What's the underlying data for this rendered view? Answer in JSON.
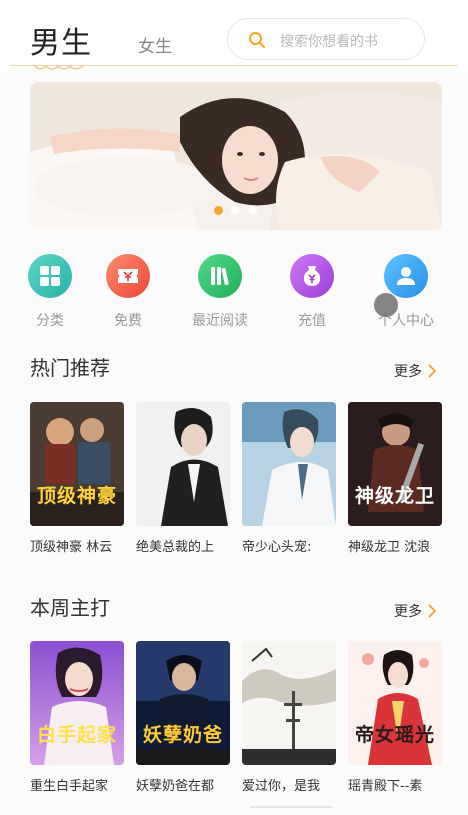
{
  "header": {
    "tab_male": "男生",
    "tab_female": "女生",
    "search_placeholder": "搜索你想看的书"
  },
  "colors": {
    "accent": "#f3a52d",
    "header_line": "#f0d9b4",
    "text_primary": "#333333",
    "text_muted": "#999999"
  },
  "nav": [
    {
      "label": "分类",
      "icon": "grid-icon",
      "color": "#38c6b5"
    },
    {
      "label": "免费",
      "icon": "ticket-icon",
      "color": "#f0614a"
    },
    {
      "label": "最近阅读",
      "icon": "books-icon",
      "color": "#2ec46c"
    },
    {
      "label": "充值",
      "icon": "coin-tag-icon",
      "color": "#b251e4"
    },
    {
      "label": "个人中心",
      "icon": "user-icon",
      "color": "#3fa6f2"
    }
  ],
  "hot": {
    "title": "热门推荐",
    "more": "更多",
    "books": [
      {
        "title": "顶级神豪 林云",
        "cover_text": "顶级神豪"
      },
      {
        "title": "绝美总裁的上",
        "cover_text": ""
      },
      {
        "title": "帝少心头宠:",
        "cover_text": ""
      },
      {
        "title": "神级龙卫 沈浪",
        "cover_text": "神级龙卫"
      }
    ]
  },
  "weekly": {
    "title": "本周主打",
    "more": "更多",
    "books": [
      {
        "title": "重生白手起家",
        "cover_text": "白手起家"
      },
      {
        "title": "妖孽奶爸在都",
        "cover_text": "妖孽奶爸"
      },
      {
        "title": "爱过你，是我",
        "cover_text": ""
      },
      {
        "title": "瑶青殿下--素",
        "cover_text": "帝女瑶光"
      }
    ]
  }
}
